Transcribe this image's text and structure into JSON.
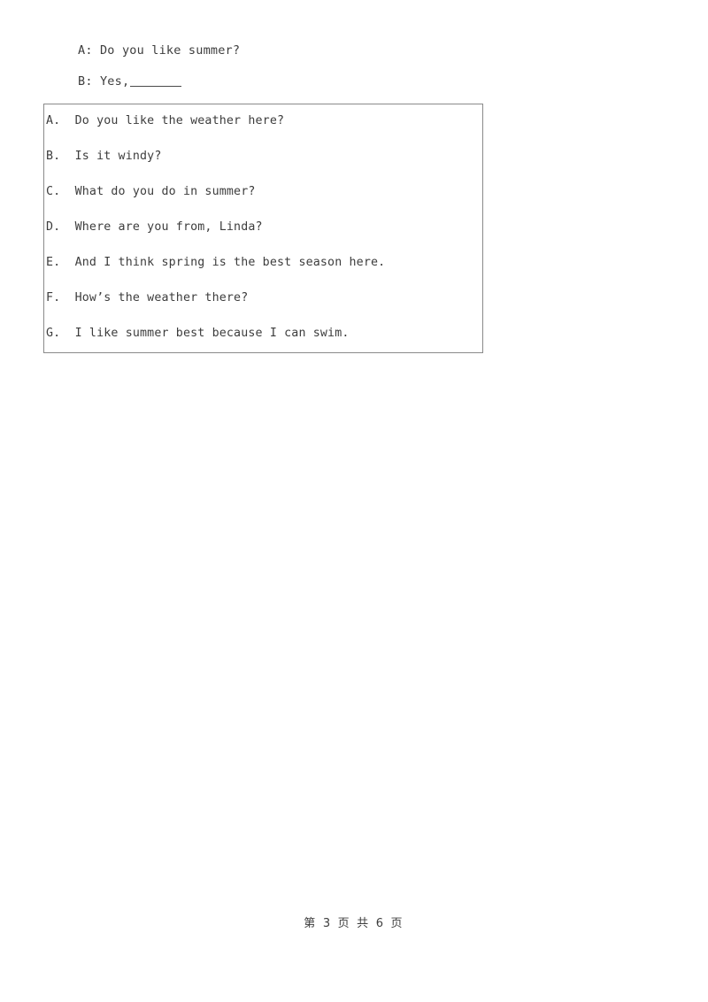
{
  "document": {
    "dialogue": {
      "lines": [
        {
          "id": "line-a",
          "text": "A: Do you like summer?",
          "has_blank": false
        },
        {
          "id": "line-b",
          "text": "B: Yes,",
          "has_blank": true
        }
      ]
    },
    "option_box": {
      "options": [
        {
          "label": "A.",
          "text": "A.  Do you like the weather here?"
        },
        {
          "label": "B.",
          "text": "B.  Is it windy?"
        },
        {
          "label": "C.",
          "text": "C.  What do you do in summer?"
        },
        {
          "label": "D.",
          "text": "D.  Where are you from, Linda?"
        },
        {
          "label": "E.",
          "text": "E.  And I think spring is the best season here."
        },
        {
          "label": "F.",
          "text": "F.  How’s the weather there?"
        },
        {
          "label": "G.",
          "text": "G.  I like summer best because I can swim."
        }
      ]
    },
    "footer": {
      "text": "第 3 页 共 6 页",
      "current_page": "3",
      "total_pages": "6"
    },
    "colors": {
      "text": "#3d3d3d",
      "border": "#8a8a8a",
      "background": "#ffffff"
    }
  }
}
